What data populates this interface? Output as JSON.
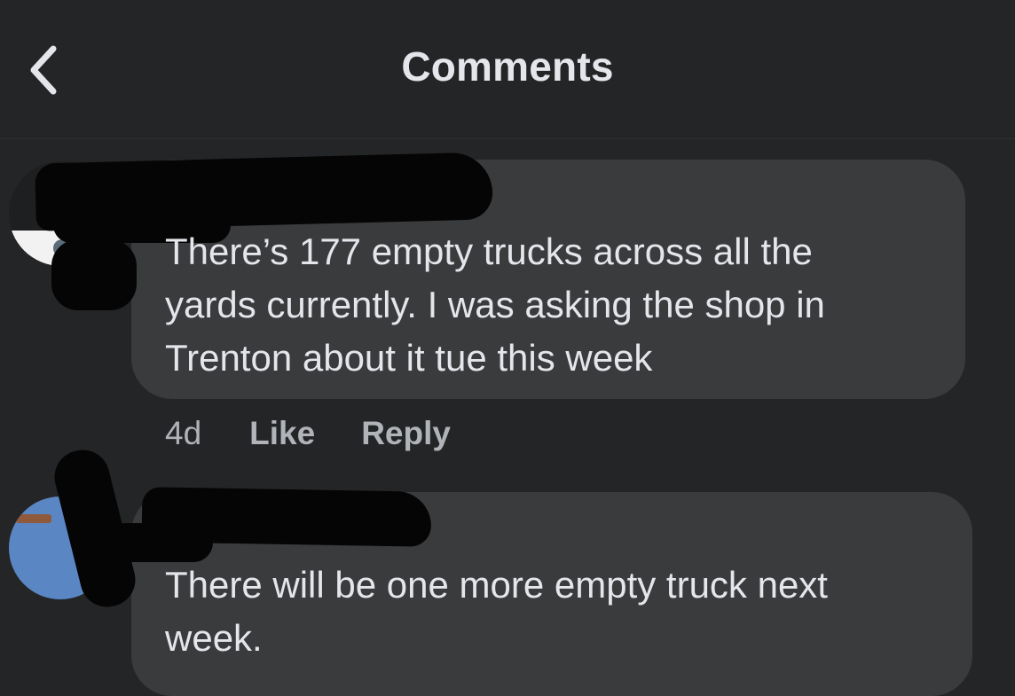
{
  "header": {
    "title": "Comments",
    "back_icon": "chevron-left-icon"
  },
  "comments": [
    {
      "author": "",
      "text": "There’s 177 empty trucks across all the\nyards currently. I was asking the shop in\nTrenton about it tue this week",
      "time": "4d",
      "like_label": "Like",
      "reply_label": "Reply"
    },
    {
      "author": "",
      "text": "There will be one more empty truck next\nweek."
    }
  ],
  "colors": {
    "background": "#242526",
    "bubble": "#3a3b3c",
    "text": "#e4e6eb",
    "meta": "#b0b3b8"
  }
}
